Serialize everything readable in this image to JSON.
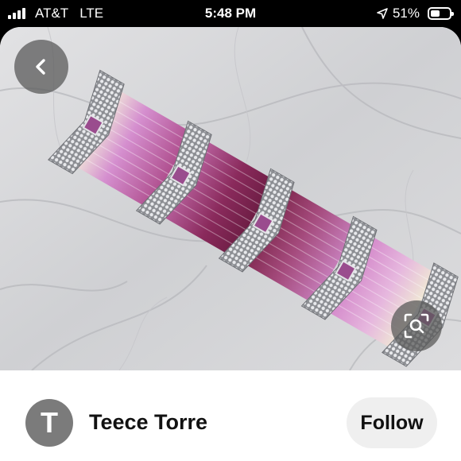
{
  "status_bar": {
    "carrier": "AT&T",
    "network": "LTE",
    "time": "5:48 PM",
    "battery_percent": "51%",
    "battery_level": 0.51,
    "location_icon": "location-arrow-icon"
  },
  "pin": {
    "back_icon": "chevron-left-icon",
    "lens_icon": "visual-search-icon"
  },
  "creator": {
    "avatar_initial": "T",
    "name": "Teece Torre",
    "follow_label": "Follow"
  },
  "colors": {
    "background": "#000000",
    "card": "#ffffff",
    "avatar": "#7b7b7b",
    "follow_button": "#efefef",
    "marble": "#d9d9db"
  }
}
